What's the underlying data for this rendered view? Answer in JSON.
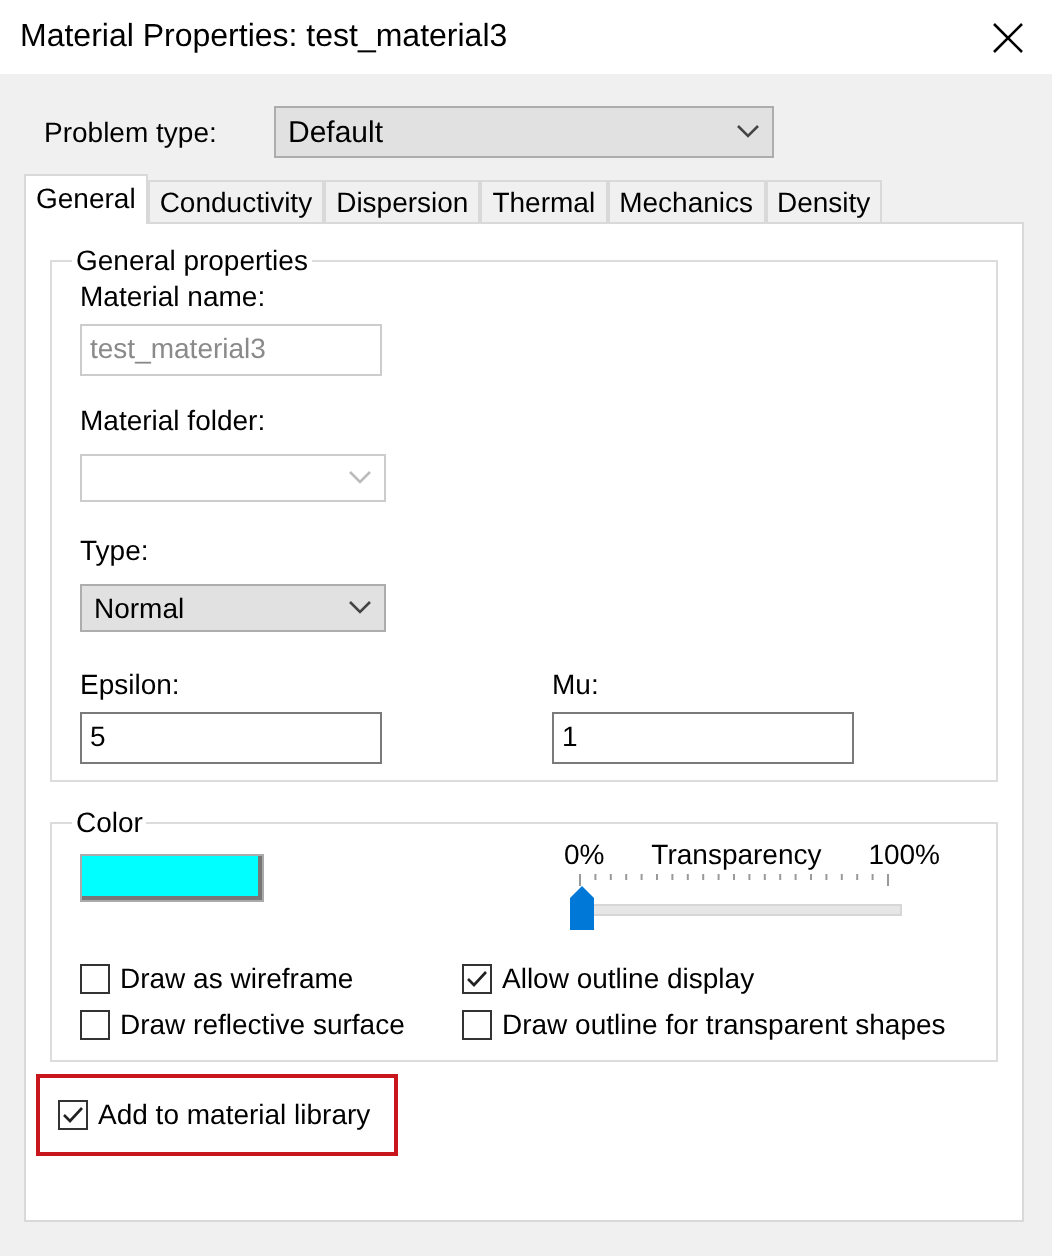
{
  "window": {
    "title": "Material Properties: test_material3"
  },
  "problem_type": {
    "label": "Problem type:",
    "value": "Default"
  },
  "tabs": [
    {
      "label": "General",
      "selected": true
    },
    {
      "label": "Conductivity",
      "selected": false
    },
    {
      "label": "Dispersion",
      "selected": false
    },
    {
      "label": "Thermal",
      "selected": false
    },
    {
      "label": "Mechanics",
      "selected": false
    },
    {
      "label": "Density",
      "selected": false
    }
  ],
  "general_properties": {
    "title": "General properties",
    "material_name": {
      "label": "Material name:",
      "value": "test_material3",
      "disabled": true
    },
    "material_folder": {
      "label": "Material folder:",
      "disabled": true
    },
    "type": {
      "label": "Type:",
      "value": "Normal"
    },
    "epsilon": {
      "label": "Epsilon:",
      "value": "5"
    },
    "mu": {
      "label": "Mu:",
      "value": "1"
    }
  },
  "color": {
    "title": "Color",
    "color": "#00ffff",
    "transparency": {
      "min_label": "0%",
      "label": "Transparency",
      "max_label": "100%",
      "level": 0
    },
    "options": [
      {
        "label": "Draw as wireframe",
        "checked": false
      },
      {
        "label": "Allow outline display",
        "checked": true
      },
      {
        "label": "Draw reflective surface",
        "checked": false
      },
      {
        "label": "Draw outline for transparent shapes",
        "checked": false
      }
    ]
  },
  "add_to_library": {
    "label": "Add to material library",
    "checked": true,
    "highlighted": true
  }
}
